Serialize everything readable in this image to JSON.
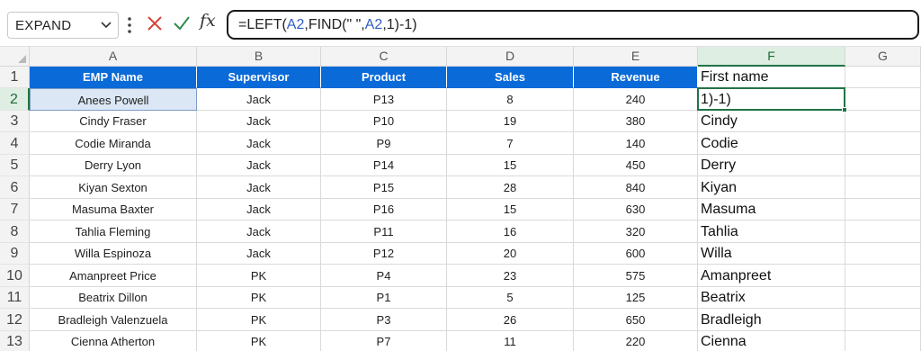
{
  "formula_bar": {
    "name_box": "EXPAND",
    "formula_parts": [
      {
        "t": "=LEFT(",
        "ref": false
      },
      {
        "t": "A2",
        "ref": true
      },
      {
        "t": ",FIND(\" \",",
        "ref": false
      },
      {
        "t": "A2",
        "ref": true
      },
      {
        "t": ",1)-1)",
        "ref": false
      }
    ],
    "icons": [
      "chevron-down-icon",
      "more-options-icon",
      "cancel-icon",
      "enter-icon",
      "insert-function-icon"
    ]
  },
  "fx_label": "fx",
  "columns": [
    "A",
    "B",
    "C",
    "D",
    "E",
    "F",
    "G"
  ],
  "active_column": "F",
  "active_row": 2,
  "row_numbers": [
    "1",
    "2",
    "3",
    "4",
    "5",
    "6",
    "7",
    "8",
    "9",
    "10",
    "11",
    "12",
    "13"
  ],
  "header_row": [
    "EMP Name",
    "Supervisor",
    "Product",
    "Sales",
    "Revenue",
    "First name"
  ],
  "rows": [
    [
      "Anees Powell",
      "Jack",
      "P13",
      "8",
      "240",
      "1)-1)"
    ],
    [
      "Cindy Fraser",
      "Jack",
      "P10",
      "19",
      "380",
      "Cindy"
    ],
    [
      "Codie Miranda",
      "Jack",
      "P9",
      "7",
      "140",
      "Codie"
    ],
    [
      "Derry Lyon",
      "Jack",
      "P14",
      "15",
      "450",
      "Derry"
    ],
    [
      "Kiyan Sexton",
      "Jack",
      "P15",
      "28",
      "840",
      "Kiyan"
    ],
    [
      "Masuma Baxter",
      "Jack",
      "P16",
      "15",
      "630",
      "Masuma"
    ],
    [
      "Tahlia Fleming",
      "Jack",
      "P11",
      "16",
      "320",
      "Tahlia"
    ],
    [
      "Willa Espinoza",
      "Jack",
      "P12",
      "20",
      "600",
      "Willa"
    ],
    [
      "Amanpreet Price",
      "PK",
      "P4",
      "23",
      "575",
      "Amanpreet"
    ],
    [
      "Beatrix Dillon",
      "PK",
      "P1",
      "5",
      "125",
      "Beatrix"
    ],
    [
      "Bradleigh Valenzuela",
      "PK",
      "P3",
      "26",
      "650",
      "Bradleigh"
    ],
    [
      "Cienna Atherton",
      "PK",
      "P7",
      "11",
      "220",
      "Cienna"
    ]
  ],
  "colors": {
    "header_fill": "#0a6ad8",
    "active_accent": "#217346",
    "formula_ref": "#2f5ec4",
    "cancel_icon": "#d9423a",
    "enter_icon": "#2f8a4c"
  }
}
